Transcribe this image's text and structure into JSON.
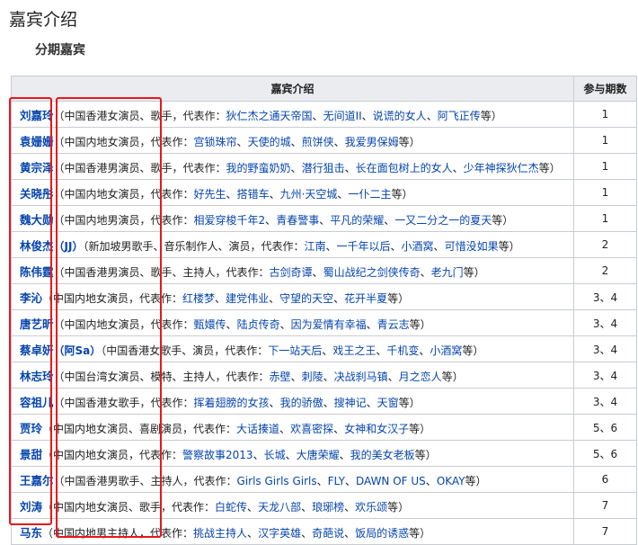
{
  "page": {
    "title": "嘉宾介绍",
    "section_title": "分期嘉宾"
  },
  "table": {
    "headers": [
      "嘉宾介绍",
      "参与期数"
    ],
    "rows": [
      {
        "name": "刘嘉玲",
        "desc_open": "（中国香港女演员、歌手，代表作：",
        "works": [
          "狄仁杰之通天帝国",
          "无间道II",
          "说谎的女人",
          "阿飞正传"
        ],
        "desc_close": "等）",
        "episodes": "1"
      },
      {
        "name": "袁姗姗",
        "desc_open": "（中国内地女演员，代表作：",
        "works": [
          "宫锁珠帘",
          "天使的城",
          "煎饼侠",
          "我爱男保姆"
        ],
        "desc_close": "等）",
        "episodes": "1"
      },
      {
        "name": "黄宗泽",
        "desc_open": "（中国香港男演员、歌手，代表作：",
        "works": [
          "我的野蛮奶奶",
          "潜行狙击",
          "长在面包树上的女人",
          "少年神探狄仁杰"
        ],
        "desc_close": "等）",
        "episodes": "1"
      },
      {
        "name": "关晓彤",
        "desc_open": "（中国内地女演员，代表作：",
        "works": [
          "好先生",
          "搭错车",
          "九州·天空城",
          "一仆二主"
        ],
        "desc_close": "等）",
        "episodes": "1"
      },
      {
        "name": "魏大勋",
        "desc_open": "（中国内地男演员，代表作：",
        "works": [
          "相爱穿梭千年2",
          "青春警事",
          "平凡的荣耀",
          "一又二分之一的夏天"
        ],
        "desc_close": "等）",
        "episodes": "1"
      },
      {
        "name": "林俊杰",
        "alias": "（JJ）",
        "desc_open": "（新加坡男歌手、音乐制作人、演员，代表作：",
        "works": [
          "江南",
          "一千年以后",
          "小酒窝",
          "可惜没如果"
        ],
        "desc_close": "等）",
        "episodes": "2"
      },
      {
        "name": "陈伟霆",
        "desc_open": "（中国香港男演员、歌手、主持人，代表作：",
        "works": [
          "古剑奇谭",
          "蜀山战纪之剑侠传奇",
          "老九门"
        ],
        "desc_close": "等）",
        "episodes": "2"
      },
      {
        "name": "李沁",
        "desc_open": "（中国内地女演员，代表作：",
        "works": [
          "红楼梦",
          "建党伟业",
          "守望的天空",
          "花开半夏"
        ],
        "desc_close": "等）",
        "episodes": "3、4"
      },
      {
        "name": "唐艺昕",
        "desc_open": "（中国内地女演员，代表作：",
        "works": [
          "甄嬛传",
          "陆贞传奇",
          "因为爱情有幸福",
          "青云志"
        ],
        "desc_close": "等）",
        "episodes": "3、4"
      },
      {
        "name": "蔡卓妍",
        "alias": "（阿Sa）",
        "desc_open": "（中国香港女歌手、演员，代表作：",
        "works": [
          "下一站天后",
          "戏王之王",
          "千机变",
          "小酒窝"
        ],
        "desc_close": "等）",
        "episodes": "3、4"
      },
      {
        "name": "林志玲",
        "desc_open": "（中国台湾女演员、模特、主持人，代表作：",
        "works": [
          "赤壁",
          "刺陵",
          "决战刹马镇",
          "月之恋人"
        ],
        "desc_close": "等）",
        "episodes": "3、4"
      },
      {
        "name": "容祖儿",
        "desc_open": "（中国香港女歌手，代表作：",
        "works": [
          "挥着翅膀的女孩",
          "我的骄傲",
          "搜神记",
          "天窗"
        ],
        "desc_close": "等）",
        "episodes": "3、4"
      },
      {
        "name": "贾玲",
        "desc_open": "（中国内地女演员、喜剧演员，代表作：",
        "works": [
          "大话揍道",
          "欢喜密探",
          "女神和女汉子"
        ],
        "desc_close": "等）",
        "episodes": "5、6"
      },
      {
        "name": "景甜",
        "desc_open": "（中国内地女演员，代表作：",
        "works": [
          "警察故事2013",
          "长城",
          "大唐荣耀",
          "我的美女老板"
        ],
        "desc_close": "等）",
        "episodes": "5、6"
      },
      {
        "name": "王嘉尔",
        "desc_open": "（中国香港男歌手、主持人，代表作：",
        "works": [
          "Girls Girls Girls",
          "FLY",
          "DAWN OF US",
          "OKAY"
        ],
        "desc_close": "等）",
        "episodes": "6"
      },
      {
        "name": "刘涛",
        "desc_open": "（中国内地女演员、歌手，代表作：",
        "works": [
          "白蛇传",
          "天龙八部",
          "琅琊榜",
          "欢乐颂"
        ],
        "desc_close": "等）",
        "episodes": "7"
      },
      {
        "name": "马东",
        "desc_open": "（中国内地男主持人，代表作：",
        "works": [
          "挑战主持人",
          "汉字英雄",
          "奇葩说",
          "饭局的诱惑"
        ],
        "desc_close": "等）",
        "episodes": "7"
      }
    ]
  },
  "colors": {
    "link": "#0645ad",
    "header_bg": "#eaecf0",
    "border": "#c8ccd1",
    "highlight_box": "#e8171c"
  }
}
